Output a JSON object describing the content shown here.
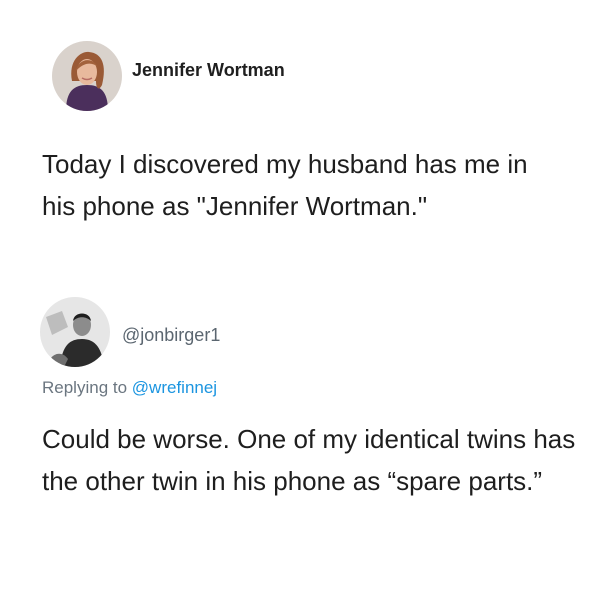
{
  "tweet": {
    "author_name": "Jennifer Wortman",
    "text": "Today I discovered my husband has me in his phone as \"Jennifer Wortman.\""
  },
  "reply": {
    "handle": "@jonbirger1",
    "replying_prefix": "Replying to",
    "replying_mention": "@wrefinnej",
    "text": "Could be worse. One of my identical twins has the other twin in his phone as “spare parts.”"
  },
  "colors": {
    "mention": "#1b95e0",
    "text": "#1e1e1e",
    "muted": "#6b7680"
  }
}
